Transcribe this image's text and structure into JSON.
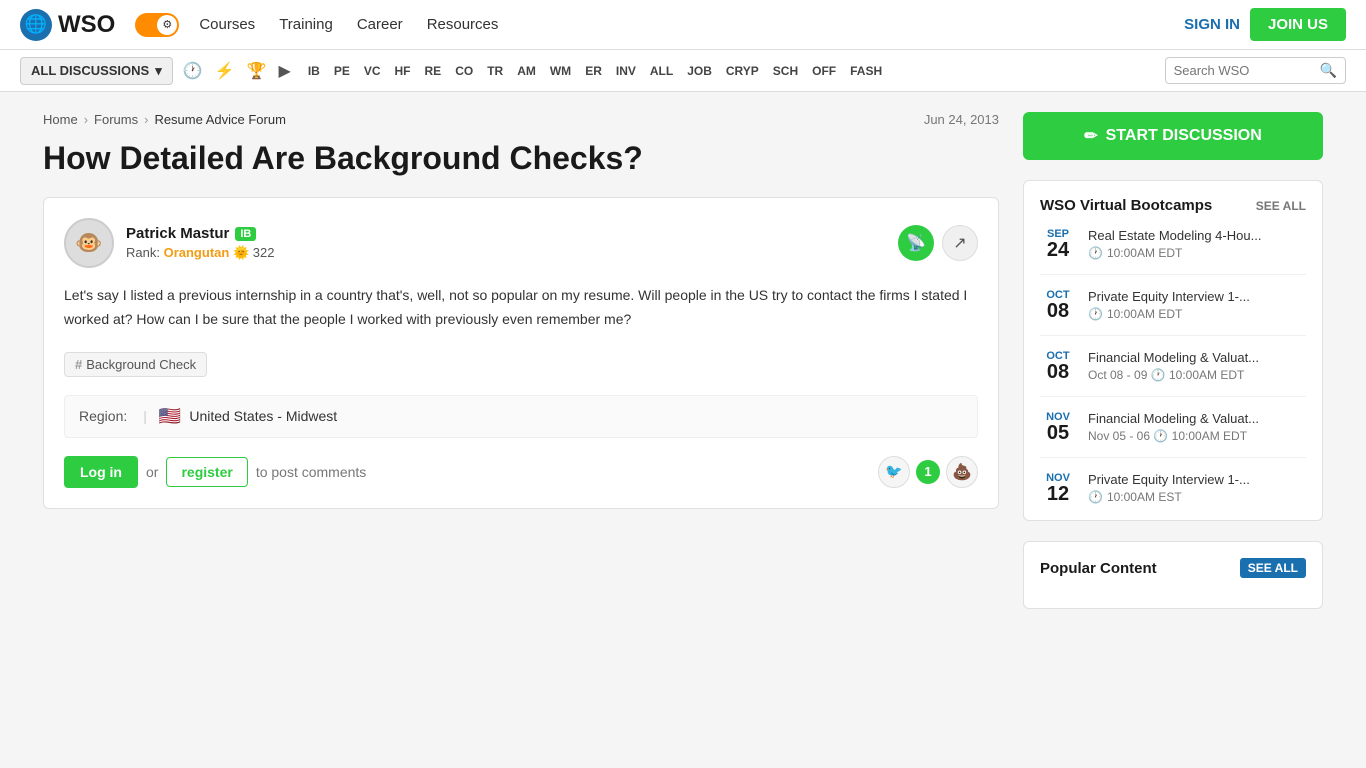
{
  "header": {
    "logo_text": "WSO",
    "nav": [
      "Courses",
      "Training",
      "Career",
      "Resources"
    ],
    "sign_in": "SIGN IN",
    "join": "JOIN US"
  },
  "sub_nav": {
    "all_discussions": "ALL DISCUSSIONS",
    "icons": [
      "clock",
      "lightning",
      "trophy",
      "video"
    ],
    "tags": [
      "IB",
      "PE",
      "VC",
      "HF",
      "RE",
      "CO",
      "TR",
      "AM",
      "WM",
      "ER",
      "INV",
      "ALL",
      "JOB",
      "CRYP",
      "SCH",
      "OFF",
      "FASH"
    ],
    "search_placeholder": "Search WSO"
  },
  "breadcrumb": {
    "home": "Home",
    "forums": "Forums",
    "current": "Resume Advice Forum",
    "date": "Jun 24, 2013"
  },
  "post": {
    "title": "How Detailed Are Background Checks?",
    "author": "Patrick Mastur",
    "badge": "IB",
    "rank_label": "Rank:",
    "rank": "Orangutan",
    "rank_score": "322",
    "body": "Let's say I listed a previous internship in a country that's, well, not so popular on my resume. Will people in the US try to contact the firms I stated I worked at? How can I be sure that the people I worked with previously even remember me?",
    "tag": "Background Check",
    "region_label": "Region:",
    "region": "United States - Midwest",
    "log_in": "Log in",
    "or": "or",
    "register": "register",
    "to_post": "to post comments",
    "upvote_count": "1"
  },
  "sidebar": {
    "start_discussion": "START DISCUSSION",
    "bootcamps_title": "WSO Virtual Bootcamps",
    "see_all": "SEE ALL",
    "events": [
      {
        "month": "Sep",
        "day": "24",
        "title": "Real Estate Modeling 4-Hou...",
        "time": "10:00AM EDT",
        "time2": null
      },
      {
        "month": "Oct",
        "day": "08",
        "title": "Private Equity Interview 1-...",
        "time": "10:00AM EDT",
        "time2": null
      },
      {
        "month": "Oct",
        "day": "08",
        "title": "Financial Modeling & Valuat...",
        "time": "10:00AM EDT",
        "time2": "Oct 08 - 09"
      },
      {
        "month": "Nov",
        "day": "05",
        "title": "Financial Modeling & Valuat...",
        "time": "10:00AM EDT",
        "time2": "Nov 05 - 06"
      },
      {
        "month": "Nov",
        "day": "12",
        "title": "Private Equity Interview 1-...",
        "time": "10:00AM EST",
        "time2": null
      }
    ],
    "popular_title": "Popular Content",
    "see_all_popular": "SEE ALL"
  }
}
